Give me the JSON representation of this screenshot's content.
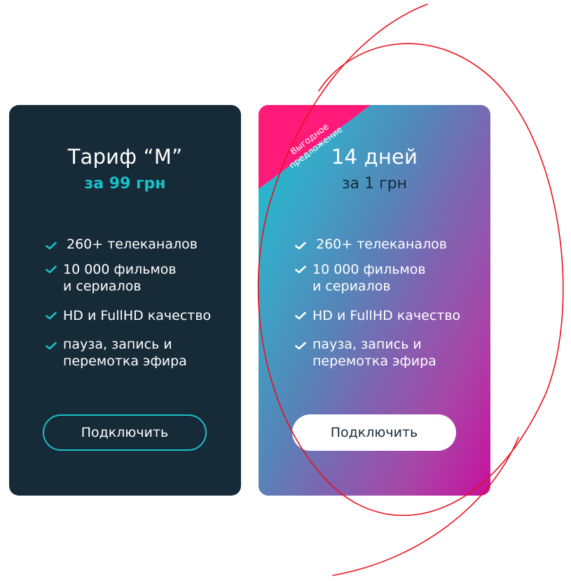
{
  "colors": {
    "page_background": "#ffffff",
    "card_dark": "#162a38",
    "accent_teal": "#19c1c9",
    "promo_gradient_start": "#19c3cf",
    "promo_gradient_end": "#c8109e",
    "ribbon_pink": "#ff1a7a",
    "annotation_red": "#e8111c"
  },
  "cards": [
    {
      "title": "Тариф “M”",
      "price": "за 99 грн",
      "features": [
        "260+ телеканалов",
        "10 000 фильмов\nи сериалов",
        "HD и FullHD качество",
        "пауза, запись и\nперемотка эфира"
      ],
      "button_label": "Подключить"
    },
    {
      "badge": "Выгодное\nпредложение",
      "title": "14 дней",
      "price": "за 1 грн",
      "features": [
        "260+ телеканалов",
        "10 000 фильмов\nи сериалов",
        "HD и FullHD качество",
        "пауза, запись и\nперемотка эфира"
      ],
      "button_label": "Подключить"
    }
  ],
  "icons": {
    "feature_bullet": "check-icon"
  }
}
